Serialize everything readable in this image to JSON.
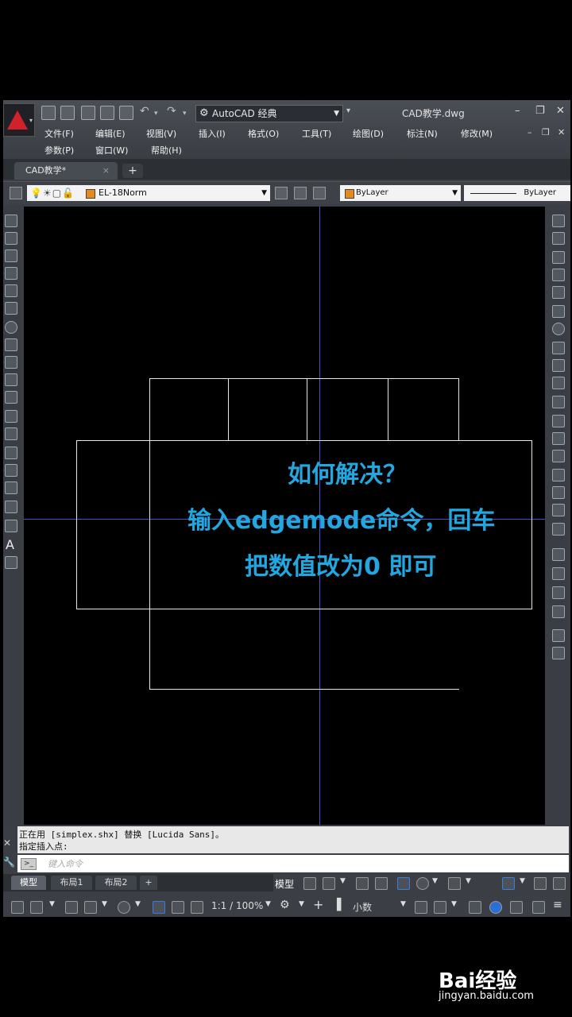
{
  "window": {
    "workspace": "AutoCAD 经典",
    "doc_title": "CAD教学.dwg"
  },
  "menu": {
    "row1": [
      "文件(F)",
      "编辑(E)",
      "视图(V)",
      "插入(I)",
      "格式(O)",
      "工具(T)",
      "绘图(D)",
      "标注(N)",
      "修改(M)"
    ],
    "row2": [
      "参数(P)",
      "窗口(W)",
      "帮助(H)"
    ]
  },
  "tabs": {
    "doc_tab": "CAD教学*",
    "close": "×",
    "new_tab": "+"
  },
  "layer_toolbar": {
    "layer_name": "EL-18Norm",
    "color": "ByLayer",
    "linetype": "ByLayer",
    "layer_color_hex": "#e88a1b"
  },
  "canvas": {
    "overlay_lines": [
      "如何解决？",
      "输入edgemode命令，回车",
      "把数值改为0 即可"
    ],
    "overlay_color": "#22a7e0"
  },
  "command": {
    "history": [
      "正在用 [simplex.shx] 替换 [Lucida Sans]。",
      "指定插入点:"
    ],
    "placeholder": "键入命令"
  },
  "layout_tabs": [
    "模型",
    "布局1",
    "布局2"
  ],
  "layout_add": "+",
  "status": {
    "model_label": "模型",
    "scale": "1:1 / 100%",
    "units": "小数"
  },
  "watermark": {
    "logo": "Bai经验",
    "url": "jingyan.baidu.com"
  }
}
